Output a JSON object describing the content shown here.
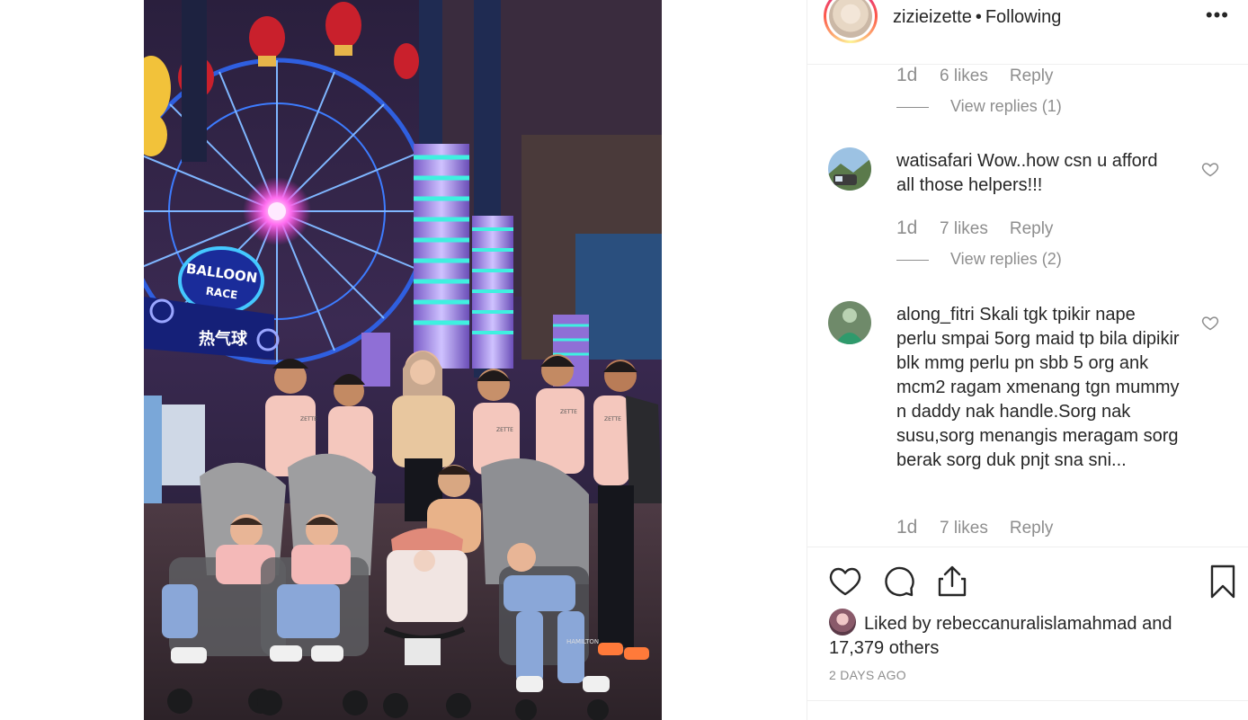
{
  "header": {
    "username": "zizieizette",
    "separator": "•",
    "follow_status": "Following",
    "more_icon": "•••"
  },
  "comments": [
    {
      "id": "c0",
      "time": "1d",
      "likes": "6 likes",
      "reply_label": "Reply",
      "view_replies": "View replies (1)"
    },
    {
      "id": "c1",
      "username": "watisafari",
      "text": "Wow..how csn u afford all those helpers!!!",
      "time": "1d",
      "likes": "7 likes",
      "reply_label": "Reply",
      "view_replies": "View replies (2)"
    },
    {
      "id": "c2",
      "username": "along_fitri",
      "text": "Skali tgk tpikir nape perlu smpai 5org maid tp bila dipikir blk mmg perlu pn sbb 5 org ank mcm2 ragam xmenang tgn mummy n daddy nak handle.Sorg nak susu,sorg menangis meragam sorg berak sorg duk pnjt sna sni...",
      "time": "1d",
      "likes": "7 likes",
      "reply_label": "Reply"
    }
  ],
  "actions": {
    "icons": [
      "heart-icon",
      "comment-icon",
      "share-icon",
      "bookmark-icon"
    ],
    "liked_prefix": "Liked by",
    "liked_user": "rebeccanuralislamahmad",
    "liked_and": "and",
    "liked_others": "17,379 others",
    "posted_ago": "2 DAYS AGO"
  },
  "photo": {
    "signs": [
      "BALLOON",
      "RACE",
      "热气球",
      "ZETTE",
      "ZETTE",
      "ZETTE",
      "ZETTE",
      "HAMILTON"
    ]
  }
}
